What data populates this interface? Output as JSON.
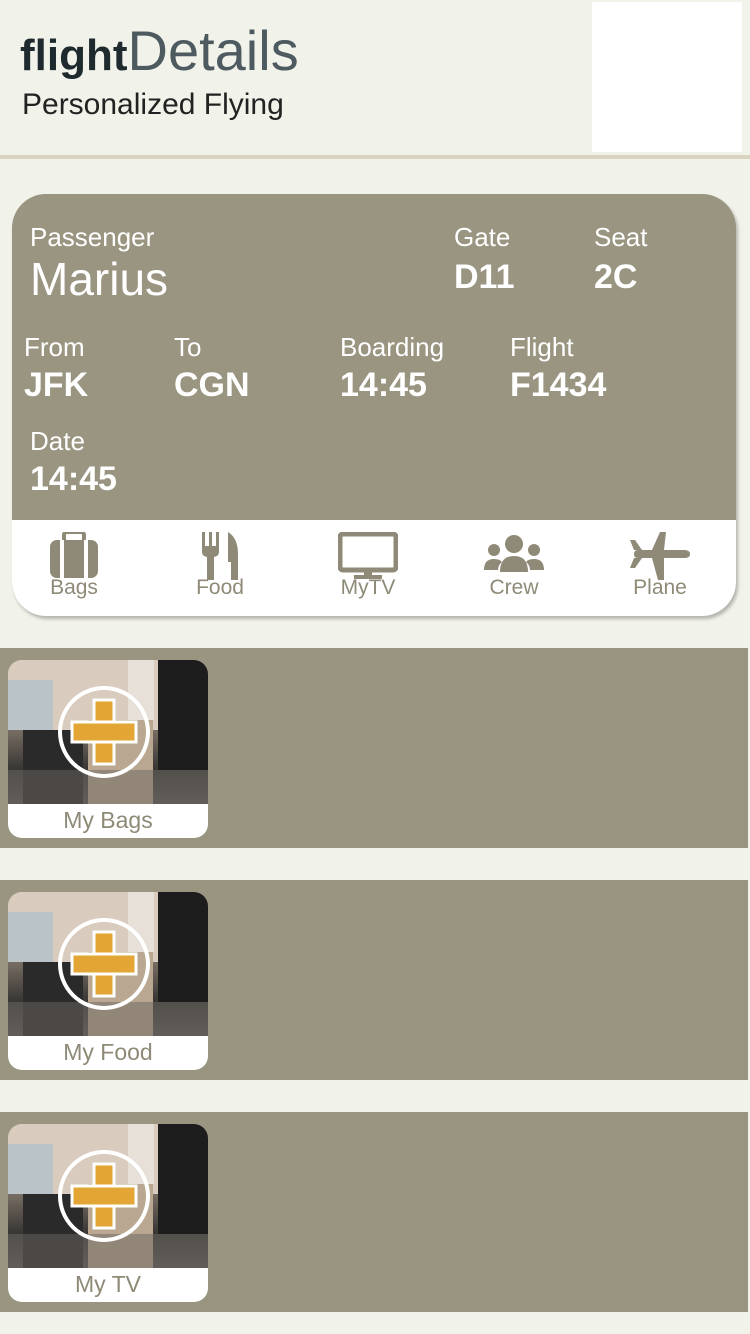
{
  "header": {
    "brand_bold": "flight",
    "brand_light": "Details",
    "tagline": "Personalized Flying"
  },
  "card": {
    "passenger_label": "Passenger",
    "passenger_name": "Marius",
    "gate_label": "Gate",
    "gate_value": "D11",
    "seat_label": "Seat",
    "seat_value": "2C",
    "from_label": "From",
    "from_value": "JFK",
    "to_label": "To",
    "to_value": "CGN",
    "boarding_label": "Boarding",
    "boarding_value": "14:45",
    "flight_label": "Flight",
    "flight_value": "F1434",
    "date_label": "Date",
    "date_value": "14:45"
  },
  "nav": [
    {
      "label": "Bags",
      "icon": "suitcase-icon"
    },
    {
      "label": "Food",
      "icon": "fork-knife-icon"
    },
    {
      "label": "MyTV",
      "icon": "monitor-icon"
    },
    {
      "label": "Crew",
      "icon": "people-icon"
    },
    {
      "label": "Plane",
      "icon": "airplane-icon"
    }
  ],
  "panels": [
    {
      "label": "My Bags"
    },
    {
      "label": "My Food"
    },
    {
      "label": "My TV"
    }
  ],
  "colors": {
    "background": "#f1f2e9",
    "card": "#9a9581",
    "accent_plus": "#e3a635",
    "nav_text": "#8e8a77"
  }
}
